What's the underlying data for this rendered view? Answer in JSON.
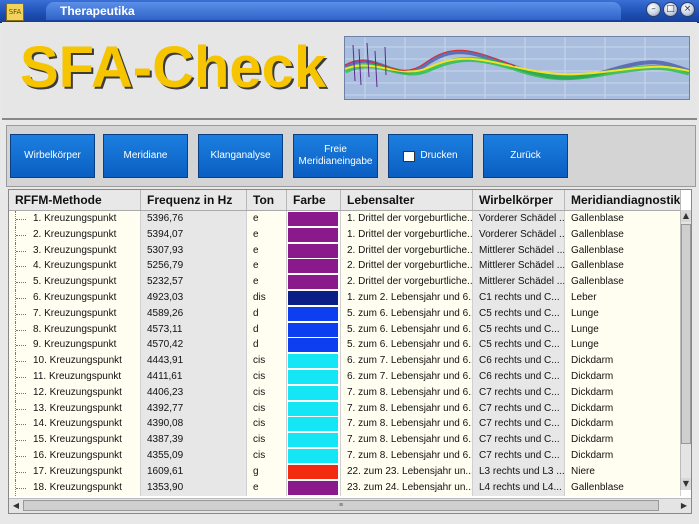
{
  "window": {
    "title": "Therapeutika",
    "app_icon_text": "SFA",
    "buttons": {
      "minimize": "–",
      "maximize": "□",
      "close": "×"
    }
  },
  "header": {
    "logo_text": "SFA-Check"
  },
  "toolbar": {
    "buttons": [
      {
        "label": "Wirbelkörper"
      },
      {
        "label": "Meridiane"
      },
      {
        "label": "Klanganalyse"
      },
      {
        "label": "Freie Meridianeingabe"
      },
      {
        "label": "Drucken"
      },
      {
        "label": "Zurück"
      }
    ]
  },
  "table": {
    "columns": [
      "RFFM-Methode",
      "Frequenz in Hz",
      "Ton",
      "Farbe",
      "Lebensalter",
      "Wirbelkörper",
      "Meridiandiagnostik"
    ],
    "rows": [
      {
        "name": "1. Kreuzungspunkt",
        "freq": "5396,76",
        "ton": "e",
        "color": "#8a1a8c",
        "leben": "1. Drittel der vorgeburtliche...",
        "wirbel": "Vorderer Schädel ...",
        "meridian": "Gallenblase"
      },
      {
        "name": "2. Kreuzungspunkt",
        "freq": "5394,07",
        "ton": "e",
        "color": "#8a1a8c",
        "leben": "1. Drittel der vorgeburtliche...",
        "wirbel": "Vorderer Schädel ...",
        "meridian": "Gallenblase"
      },
      {
        "name": "3. Kreuzungspunkt",
        "freq": "5307,93",
        "ton": "e",
        "color": "#8a1a8c",
        "leben": "2. Drittel der vorgeburtliche...",
        "wirbel": "Mittlerer Schädel ...",
        "meridian": "Gallenblase"
      },
      {
        "name": "4. Kreuzungspunkt",
        "freq": "5256,79",
        "ton": "e",
        "color": "#8a1a8c",
        "leben": "2. Drittel der vorgeburtliche...",
        "wirbel": "Mittlerer Schädel ...",
        "meridian": "Gallenblase"
      },
      {
        "name": "5. Kreuzungspunkt",
        "freq": "5232,57",
        "ton": "e",
        "color": "#8a1a8c",
        "leben": "2. Drittel der vorgeburtliche...",
        "wirbel": "Mittlerer Schädel ...",
        "meridian": "Gallenblase"
      },
      {
        "name": "6. Kreuzungspunkt",
        "freq": "4923,03",
        "ton": "dis",
        "color": "#0a1f86",
        "leben": "1. zum 2. Lebensjahr und 6...",
        "wirbel": "C1  rechts und C...",
        "meridian": "Leber"
      },
      {
        "name": "7. Kreuzungspunkt",
        "freq": "4589,26",
        "ton": "d",
        "color": "#0d3ff0",
        "leben": "5. zum 6. Lebensjahr und 6...",
        "wirbel": "C5  rechts und C...",
        "meridian": "Lunge"
      },
      {
        "name": "8. Kreuzungspunkt",
        "freq": "4573,11",
        "ton": "d",
        "color": "#0d3ff0",
        "leben": "5. zum 6. Lebensjahr und 6...",
        "wirbel": "C5  rechts und C...",
        "meridian": "Lunge"
      },
      {
        "name": "9. Kreuzungspunkt",
        "freq": "4570,42",
        "ton": "d",
        "color": "#0d3ff0",
        "leben": "5. zum 6. Lebensjahr und 6...",
        "wirbel": "C5  rechts und C...",
        "meridian": "Lunge"
      },
      {
        "name": "10. Kreuzungspunkt",
        "freq": "4443,91",
        "ton": "cis",
        "color": "#14e6f5",
        "leben": "6. zum 7. Lebensjahr und 6...",
        "wirbel": "C6  rechts und C...",
        "meridian": "Dickdarm"
      },
      {
        "name": "11. Kreuzungspunkt",
        "freq": "4411,61",
        "ton": "cis",
        "color": "#14e6f5",
        "leben": "6. zum 7. Lebensjahr und 6...",
        "wirbel": "C6  rechts und C...",
        "meridian": "Dickdarm"
      },
      {
        "name": "12. Kreuzungspunkt",
        "freq": "4406,23",
        "ton": "cis",
        "color": "#14e6f5",
        "leben": "7. zum 8. Lebensjahr und 6...",
        "wirbel": "C7  rechts und C...",
        "meridian": "Dickdarm"
      },
      {
        "name": "13. Kreuzungspunkt",
        "freq": "4392,77",
        "ton": "cis",
        "color": "#14e6f5",
        "leben": "7. zum 8. Lebensjahr und 6...",
        "wirbel": "C7  rechts und C...",
        "meridian": "Dickdarm"
      },
      {
        "name": "14. Kreuzungspunkt",
        "freq": "4390,08",
        "ton": "cis",
        "color": "#14e6f5",
        "leben": "7. zum 8. Lebensjahr und 6...",
        "wirbel": "C7  rechts und C...",
        "meridian": "Dickdarm"
      },
      {
        "name": "15. Kreuzungspunkt",
        "freq": "4387,39",
        "ton": "cis",
        "color": "#14e6f5",
        "leben": "7. zum 8. Lebensjahr und 6...",
        "wirbel": "C7  rechts und C...",
        "meridian": "Dickdarm"
      },
      {
        "name": "16. Kreuzungspunkt",
        "freq": "4355,09",
        "ton": "cis",
        "color": "#14e6f5",
        "leben": "7. zum 8. Lebensjahr und 6...",
        "wirbel": "C7  rechts und C...",
        "meridian": "Dickdarm"
      },
      {
        "name": "17. Kreuzungspunkt",
        "freq": "1609,61",
        "ton": "g",
        "color": "#f22a0f",
        "leben": "22. zum 23. Lebensjahr un...",
        "wirbel": "L3 rechts und L3 ...",
        "meridian": "Niere"
      },
      {
        "name": "18. Kreuzungspunkt",
        "freq": "1353,90",
        "ton": "e",
        "color": "#8a1a8c",
        "leben": "23. zum 24. Lebensjahr un...",
        "wirbel": "L4  rechts und L4...",
        "meridian": "Gallenblase"
      }
    ]
  },
  "scrollbars": {
    "up": "▲",
    "down": "▼",
    "left": "◀",
    "right": "▶",
    "grip": "≡"
  }
}
